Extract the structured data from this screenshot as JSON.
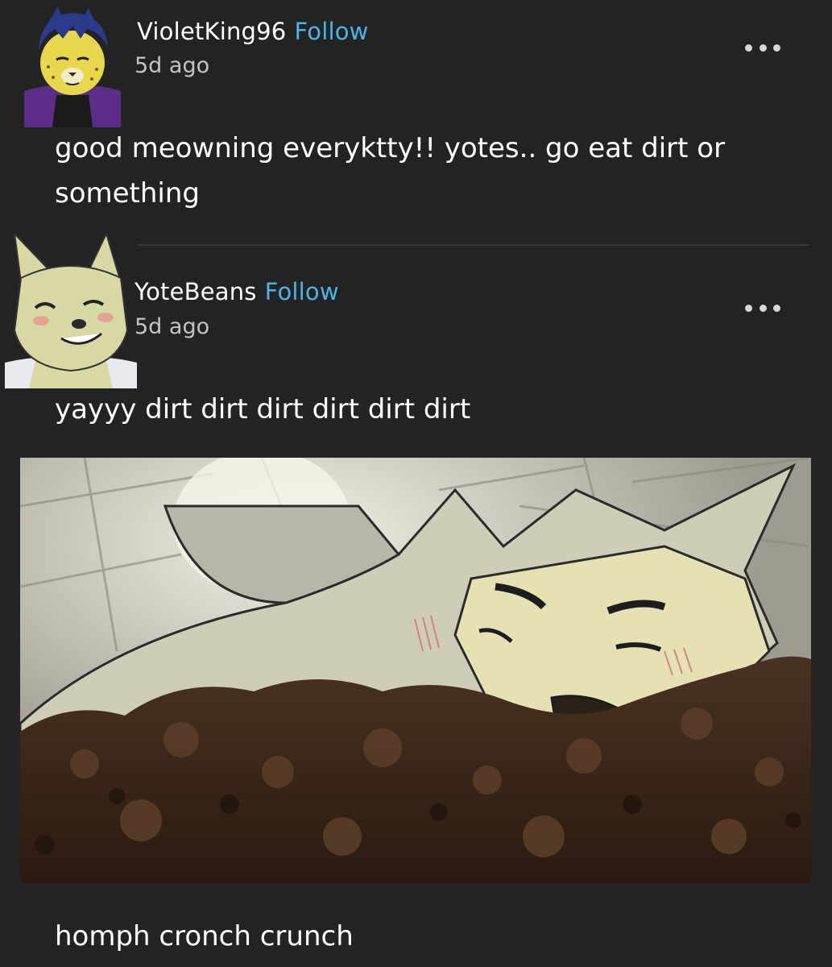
{
  "feed": {
    "posts": [
      {
        "username": "VioletKing96",
        "follow_label": "Follow",
        "timestamp": "5d ago",
        "body": "good meowning everyktty!! yotes.. go eat dirt or something",
        "avatar": "cheetah-avatar"
      },
      {
        "username": "YoteBeans",
        "follow_label": "Follow",
        "timestamp": "5d ago",
        "body": "yayyy dirt dirt dirt dirt dirt dirt",
        "avatar": "coyote-avatar",
        "image": "coyote-eating-dirt-image",
        "caption": "homph cronch crunch"
      }
    ]
  },
  "colors": {
    "background": "#232323",
    "text": "#ffffff",
    "follow_link": "#4db3e6",
    "timestamp": "#c4c4c4"
  },
  "icons": {
    "more_options": "more-horizontal-icon"
  }
}
